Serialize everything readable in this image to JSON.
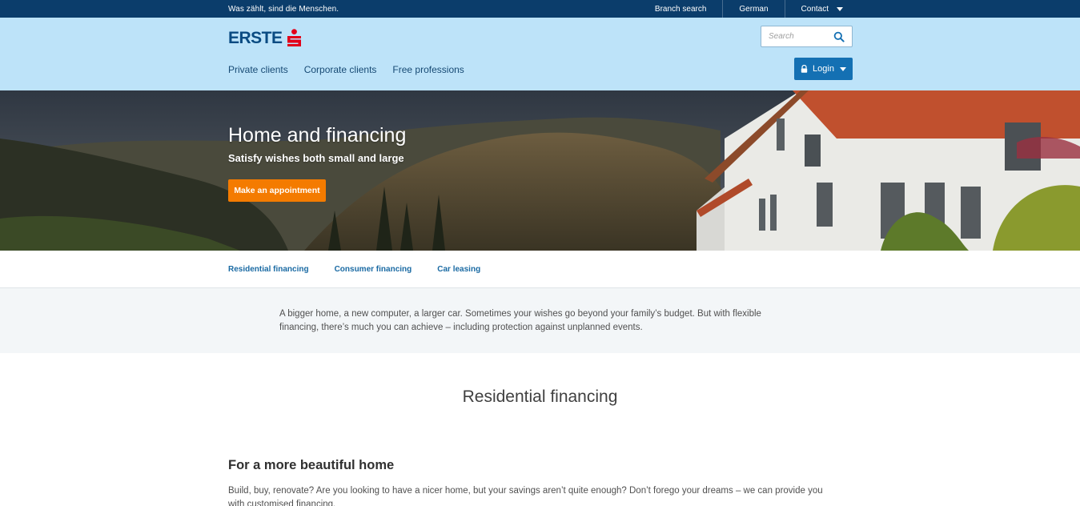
{
  "topbar": {
    "tagline": "Was zählt, sind die Menschen.",
    "links": [
      "Branch search",
      "German",
      "Contact"
    ]
  },
  "header": {
    "logo_text": "ERSTE",
    "search_placeholder": "Search",
    "nav": [
      "Private clients",
      "Corporate clients",
      "Free professions"
    ],
    "login_label": "Login"
  },
  "hero": {
    "title": "Home and financing",
    "subtitle": "Satisfy wishes both small and large",
    "cta_label": "Make an appointment"
  },
  "subnav": [
    "Residential financing",
    "Consumer financing",
    "Car leasing"
  ],
  "intro": {
    "text": "A bigger home, a new computer, a larger car. Sometimes your wishes go beyond your family’s budget. But with flexible financing, there’s much you can achieve – including protection against unplanned events."
  },
  "content": {
    "section_title": "Residential financing",
    "heading": "For a more beautiful home",
    "text": "Build, buy, renovate? Are you looking to have a nicer home, but your savings aren’t quite enough? Don’t forego your dreams – we can provide you with customised financing."
  },
  "colors": {
    "topbar": "#0b3d6b",
    "header_bg": "#bde3f9",
    "brand_blue": "#0a4b82",
    "brand_red": "#e2001a",
    "login_button": "#1470b3",
    "cta_orange": "#f47b00",
    "link_blue": "#1a6aa3"
  },
  "icons": {
    "search": "search-icon",
    "lock": "lock-icon",
    "caret": "chevron-down-icon",
    "logo_mark": "erste-s-logo-icon"
  }
}
